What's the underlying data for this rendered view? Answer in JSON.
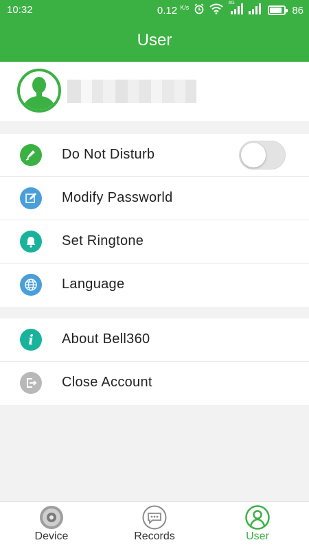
{
  "status_bar": {
    "time": "10:32",
    "net_speed": "0.12",
    "net_speed_unit": "K/s",
    "network_label": "4G",
    "battery": "86",
    "battery_level": 0.86
  },
  "header": {
    "title": "User"
  },
  "profile": {
    "username": ""
  },
  "settings": [
    {
      "label": "Do Not Disturb",
      "icon": "dnd-icon",
      "color": "#3bb143",
      "toggle": false
    },
    {
      "label": "Modify Passworld",
      "icon": "edit-icon",
      "color": "#4a9ed9"
    },
    {
      "label": "Set Ringtone",
      "icon": "bell-icon",
      "color": "#19b39b"
    },
    {
      "label": "Language",
      "icon": "globe-icon",
      "color": "#4a9ed9"
    }
  ],
  "info": [
    {
      "label": "About Bell360",
      "icon": "info-icon",
      "color": "#19b39b"
    },
    {
      "label": "Close Account",
      "icon": "logout-icon",
      "color": "#b8b8b8"
    }
  ],
  "tabs": [
    {
      "label": "Device",
      "icon": "camera-icon",
      "active": false
    },
    {
      "label": "Records",
      "icon": "chat-icon",
      "active": false
    },
    {
      "label": "User",
      "icon": "user-icon",
      "active": true
    }
  ],
  "colors": {
    "accent": "#3bb143",
    "background": "#f2f2f2"
  }
}
